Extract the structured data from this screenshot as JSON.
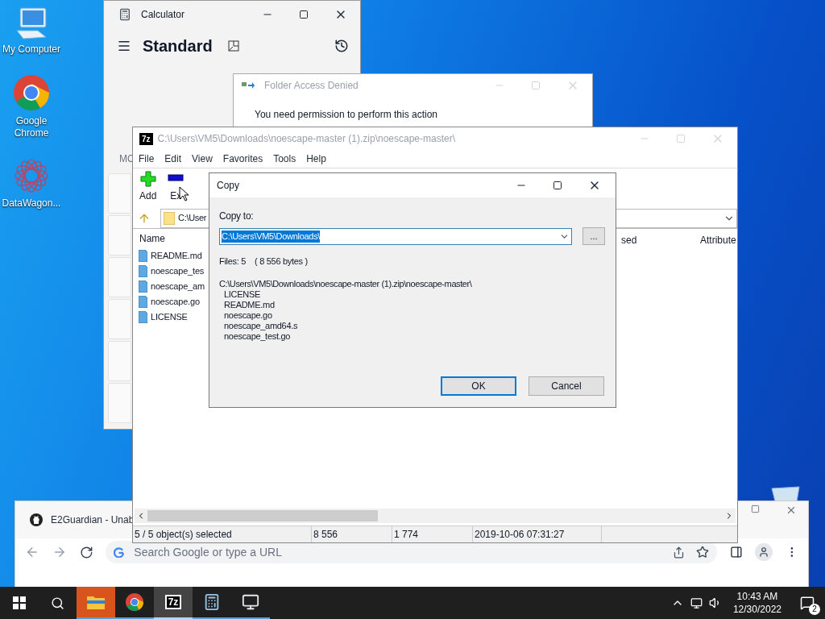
{
  "desktop_icons": [
    {
      "label": "My Computer",
      "kind": "computer"
    },
    {
      "label": "Google Chrome",
      "kind": "chrome"
    },
    {
      "label": "DataWagon...",
      "kind": "datawagon"
    }
  ],
  "calculator": {
    "title": "Calculator",
    "mode": "Standard",
    "memory_label": "MC"
  },
  "access_denied": {
    "title": "Folder Access Denied",
    "message": "You need permission to perform this action"
  },
  "sevenzip": {
    "logo": "7z",
    "title": "C:\\Users\\VM5\\Downloads\\noescape-master (1).zip\\noescape-master\\",
    "menu": [
      "File",
      "Edit",
      "View",
      "Favorites",
      "Tools",
      "Help"
    ],
    "toolbar": [
      {
        "label": "Add",
        "kind": "add"
      },
      {
        "label": "Ex",
        "kind": "extract"
      }
    ],
    "address": "C:\\User",
    "columns": [
      "Name",
      "sed",
      "Attribute"
    ],
    "files": [
      "README.md",
      "noescape_tes",
      "noescape_am",
      "noescape.go",
      "LICENSE"
    ],
    "status": [
      "5 / 5 object(s) selected",
      "8 556",
      "1 774",
      "2019-10-06 07:31:27"
    ]
  },
  "copy_dialog": {
    "title": "Copy",
    "copy_to_label": "Copy to:",
    "path": "C:\\Users\\VM5\\Downloads\\",
    "browse": "...",
    "summary": "Files: 5    ( 8 556 bytes )",
    "source": "C:\\Users\\VM5\\Downloads\\noescape-master (1).zip\\noescape-master\\",
    "files": [
      "LICENSE",
      "README.md",
      "noescape.go",
      "noescape_amd64.s",
      "noescape_test.go"
    ],
    "buttons": [
      {
        "label": "OK",
        "default": true
      },
      {
        "label": "Cancel",
        "default": false
      }
    ]
  },
  "browser": {
    "tab_title": "E2Guardian - Unab",
    "address_placeholder": "Search Google or type a URL"
  },
  "taskbar": {
    "apps": [
      {
        "kind": "explorer",
        "active": false,
        "flashing": true
      },
      {
        "kind": "chrome",
        "active": false,
        "flashing": false
      },
      {
        "kind": "sevenzip",
        "label": "7z",
        "active": true,
        "flashing": false
      },
      {
        "kind": "calculator",
        "active": false,
        "flashing": false
      },
      {
        "kind": "monitor",
        "active": false,
        "flashing": false
      }
    ],
    "time": "10:43 AM",
    "date": "12/30/2022",
    "notifications": "2"
  }
}
